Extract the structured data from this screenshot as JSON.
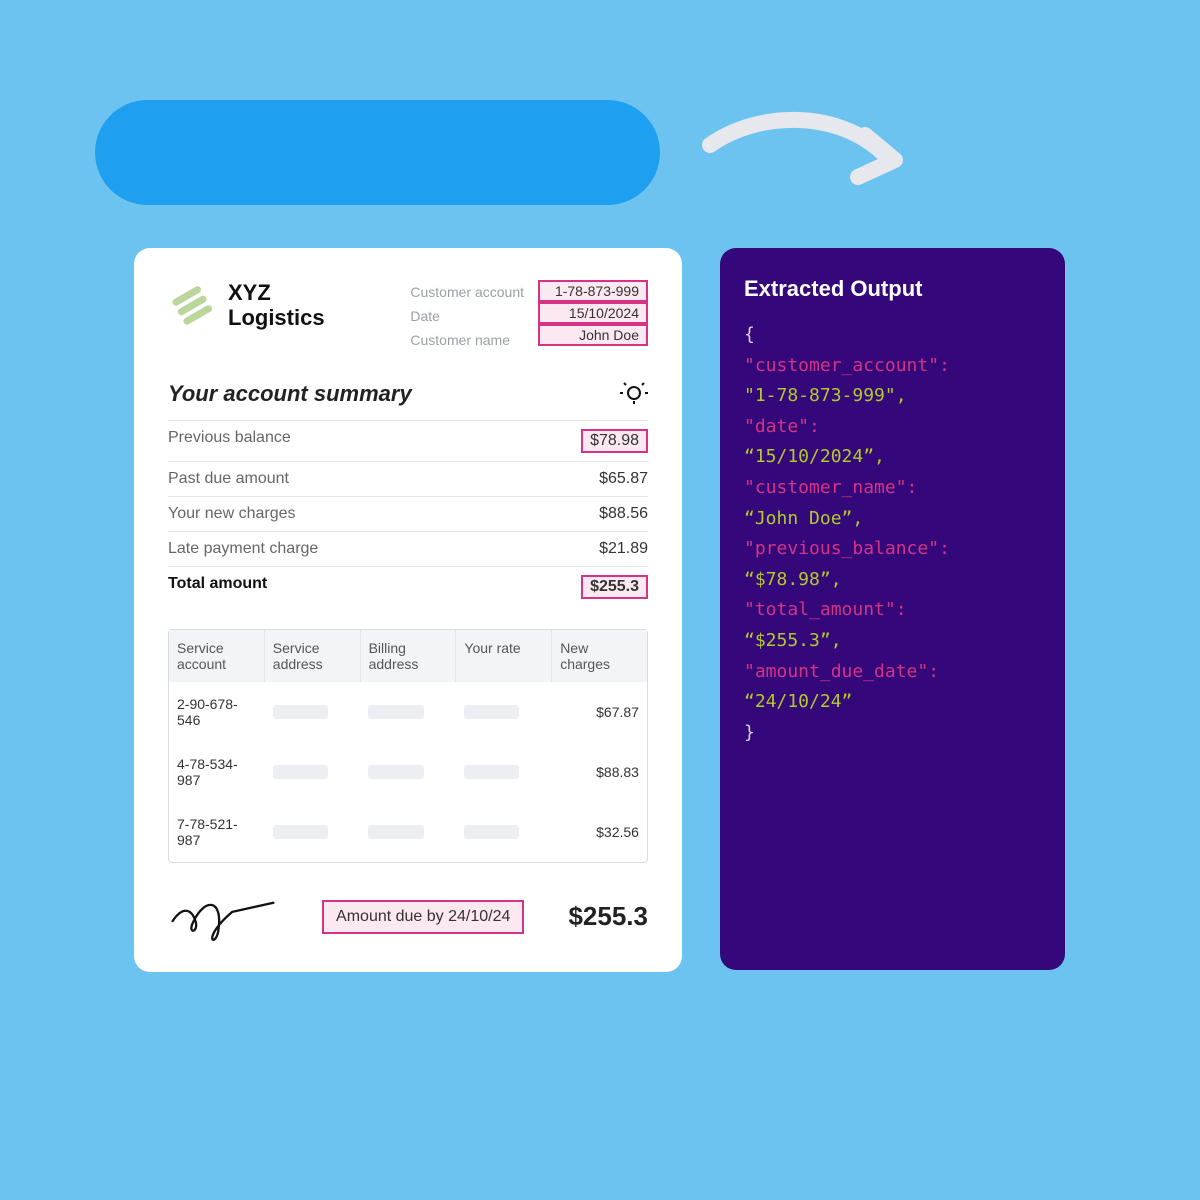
{
  "brand": {
    "line1": "XYZ",
    "line2": "Logistics"
  },
  "meta": {
    "labels": {
      "account": "Customer account",
      "date": "Date",
      "name": "Customer name"
    },
    "values": {
      "account": "1-78-873-999",
      "date": "15/10/2024",
      "name": "John Doe"
    }
  },
  "summary": {
    "title": "Your account summary",
    "rows": [
      {
        "label": "Previous balance",
        "value": "$78.98",
        "highlight": true
      },
      {
        "label": "Past due amount",
        "value": "$65.87"
      },
      {
        "label": "Your new charges",
        "value": "$88.56"
      },
      {
        "label": "Late payment charge",
        "value": "$21.89"
      }
    ],
    "total": {
      "label": "Total amount",
      "value": "$255.3"
    }
  },
  "table": {
    "headers": [
      "Service account",
      "Service address",
      "Billing address",
      "Your rate",
      "New charges"
    ],
    "rows": [
      {
        "acct": "2-90-678-546",
        "charge": "$67.87"
      },
      {
        "acct": "4-78-534-987",
        "charge": "$88.83"
      },
      {
        "acct": "7-78-521-987",
        "charge": "$32.56"
      }
    ]
  },
  "footer": {
    "due_label": "Amount due by 24/10/24",
    "total": "$255.3"
  },
  "output": {
    "title": "Extracted Output",
    "entries": [
      {
        "key": "\"customer_account\":",
        "val": "\"1-78-873-999\","
      },
      {
        "key": "\"date\":",
        "val": "“15/10/2024”,"
      },
      {
        "key": "\"customer_name\":",
        "val": "“John Doe”,"
      },
      {
        "key": "\"previous_balance\":",
        "val": "“$78.98”,"
      },
      {
        "key": "\"total_amount\":",
        "val": "“$255.3”,"
      },
      {
        "key": "\"amount_due_date\":",
        "val": "“24/10/24”"
      }
    ]
  }
}
